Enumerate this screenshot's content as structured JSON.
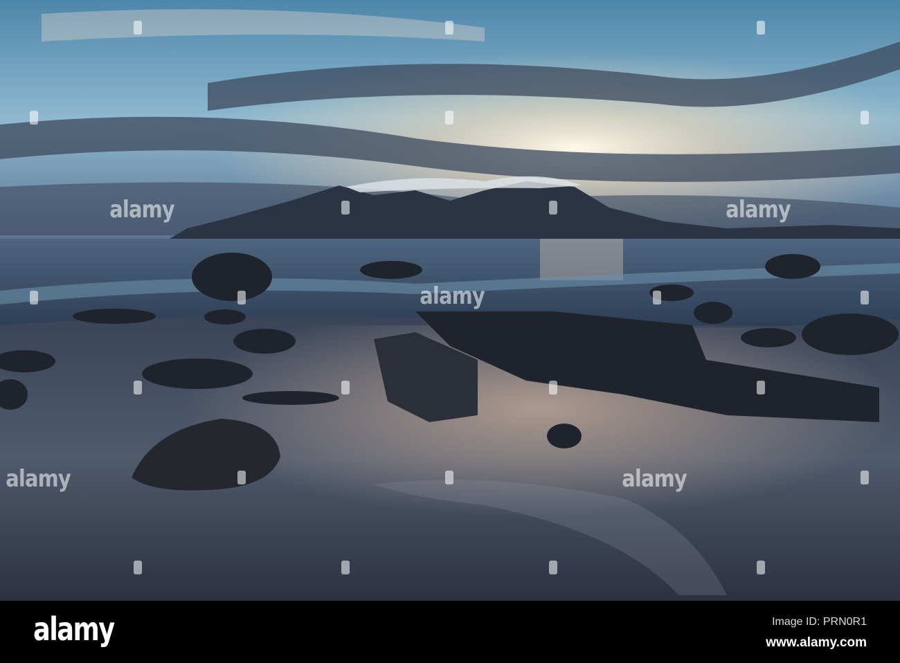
{
  "photo": {
    "subject": "sunset-beach-rocks-mountain-island",
    "colors": {
      "sky_top": "#4f86a8",
      "sky_glow": "#fff4dc",
      "sea": "#3b4f68",
      "sand": "#4a5566",
      "rock": "#1e2228"
    }
  },
  "watermark": {
    "text": "alamy"
  },
  "footer": {
    "logo": "alamy",
    "image_id": "Image ID: PRN0R1",
    "url": "www.alamy.com"
  }
}
